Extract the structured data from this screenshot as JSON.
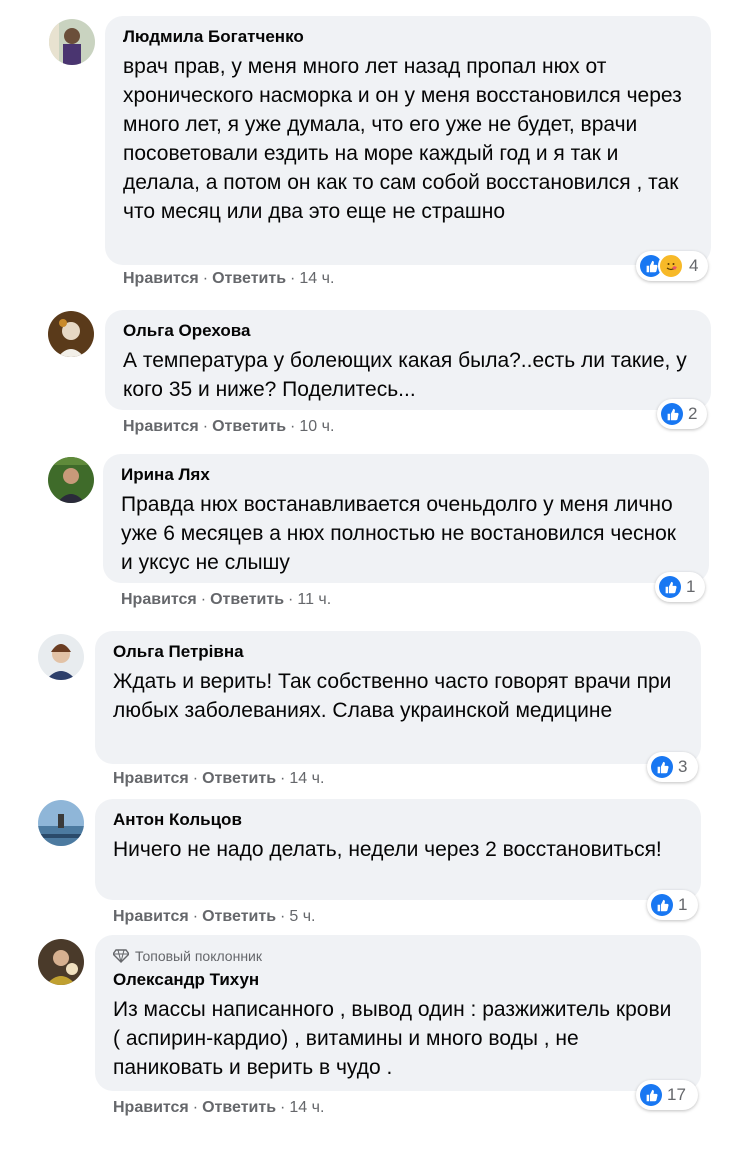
{
  "comments": [
    {
      "author": "Людмила Богатченко",
      "text": "врач прав, у меня много лет назад пропал нюх от хронического насморка и он у меня восстановился через много лет, я уже думала, что его уже не будет, врачи посоветовали ездить на море каждый год и я так и делала, а потом он как то сам собой восстановился , так что месяц или два это еще не страшно",
      "like": "Нравится",
      "reply": "Ответить",
      "time": "14 ч.",
      "reaction_count": "4",
      "reactions": [
        "like-icon",
        "care-icon"
      ]
    },
    {
      "author": "Ольга Орехова",
      "text": "А температура у болеющих какая была?..есть ли такие, у кого 35 и ниже? Поделитесь...",
      "like": "Нравится",
      "reply": "Ответить",
      "time": "10 ч.",
      "reaction_count": "2",
      "reactions": [
        "like-icon"
      ]
    },
    {
      "author": "Ирина Лях",
      "text": "Правда нюх востанавливается оченьдолго у меня лично уже 6 месяцев а нюх полностью не востановился чеснок и уксус не слышу",
      "like": "Нравится",
      "reply": "Ответить",
      "time": "11 ч.",
      "reaction_count": "1",
      "reactions": [
        "like-icon"
      ]
    },
    {
      "author": "Ольга Петрівна",
      "text": "Ждать и верить! Так собственно часто говорят врачи при любых заболеваниях. Слава украинской медицине",
      "like": "Нравится",
      "reply": "Ответить",
      "time": "14 ч.",
      "reaction_count": "3",
      "reactions": [
        "like-icon"
      ]
    },
    {
      "author": "Антон Кольцов",
      "text": "Ничего не надо делать, недели через 2 восстановиться!",
      "like": "Нравится",
      "reply": "Ответить",
      "time": "5 ч.",
      "reaction_count": "1",
      "reactions": [
        "like-icon"
      ]
    },
    {
      "badge": "Топовый поклонник",
      "author": "Олександр Тихун",
      "text": "Из массы написанного , вывод один : разжижитель крови ( аспирин-кардио) , витамины и много воды , не паниковать и верить в чудо .",
      "like": "Нравится",
      "reply": "Ответить",
      "time": "14 ч.",
      "reaction_count": "17",
      "reactions": [
        "like-icon"
      ]
    }
  ],
  "colors": {
    "bubble": "#f0f2f5",
    "like_blue": "#1877f2",
    "meta_gray": "#65676b",
    "text": "#050505"
  }
}
